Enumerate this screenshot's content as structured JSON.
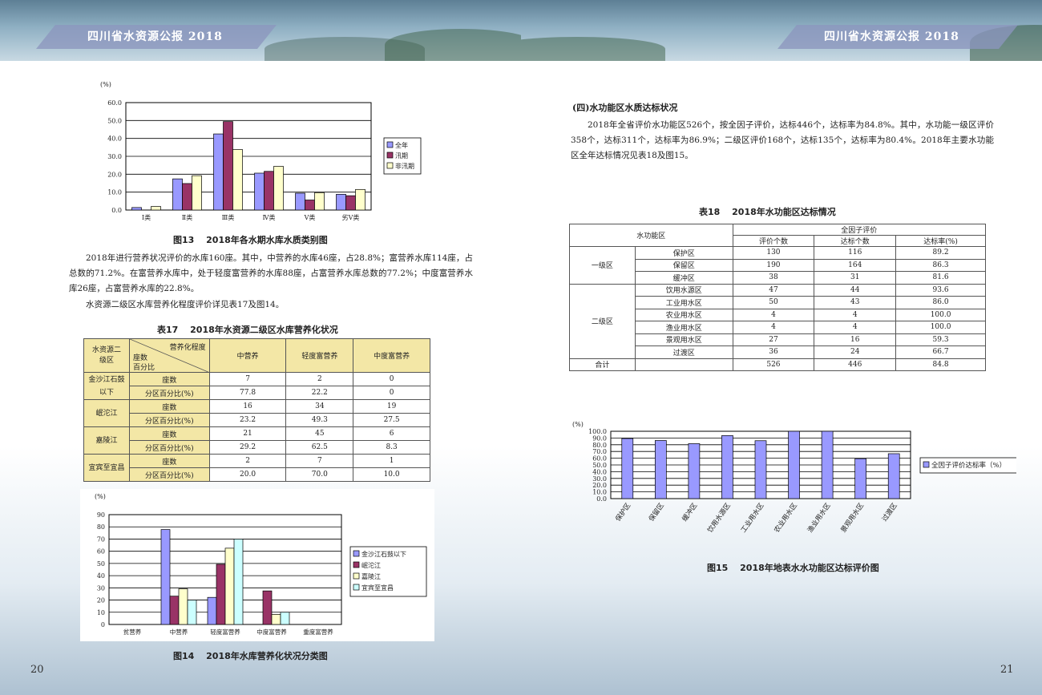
{
  "header": {
    "title": "四川省水资源公报 2018"
  },
  "page_numbers": {
    "left": "20",
    "right": "21"
  },
  "left": {
    "fig13": {
      "caption": "图13　 2018年各水期水库水质类别图",
      "chart_data": {
        "type": "bar",
        "ylabel": "(%)",
        "ylim": [
          0,
          60
        ],
        "yticks": [
          "0.0",
          "10.0",
          "20.0",
          "30.0",
          "40.0",
          "50.0",
          "60.0"
        ],
        "categories": [
          "Ⅰ类",
          "Ⅱ类",
          "Ⅲ类",
          "Ⅳ类",
          "Ⅴ类",
          "劣Ⅴ类"
        ],
        "series": [
          {
            "name": "全年",
            "color": "#9999ff",
            "values": [
              1.4,
              17.4,
              42.5,
              20.6,
              9.4,
              8.8
            ]
          },
          {
            "name": "汛期",
            "color": "#993366",
            "values": [
              0,
              14.8,
              49.4,
              21.6,
              5.6,
              8.0
            ]
          },
          {
            "name": "非汛期",
            "color": "#ffffcc",
            "values": [
              2.0,
              19.2,
              33.8,
              24.4,
              9.7,
              11.5
            ]
          }
        ],
        "legend": "right"
      }
    },
    "para1": "2018年进行营养状况评价的水库160座。其中，中营养的水库46座，占28.8%；富营养水库114座，占总数的71.2%。在富营养水库中，处于轻度富营养的水库88座，占富营养水库总数的77.2%；中度富营养水库26座，占富营养水库的22.8%。",
    "para2": "水资源二级区水库营养化程度评价详见表17及图14。",
    "table17": {
      "caption": "表17　 2018年水资源二级区水库营养化状况",
      "corner_top": "营养化程度",
      "corner_region": "水资源二级区",
      "corner_mid": "座数",
      "corner_bottom": "百分比",
      "col_headers": [
        "中营养",
        "轻度富营养",
        "中度富营养"
      ],
      "label_count": "座数",
      "label_pct": "分区百分比(%)",
      "groups": [
        {
          "name": "金沙江石鼓以下",
          "counts": [
            "7",
            "2",
            "0"
          ],
          "pcts": [
            "77.8",
            "22.2",
            "0"
          ]
        },
        {
          "name": "岷沱江",
          "counts": [
            "16",
            "34",
            "19"
          ],
          "pcts": [
            "23.2",
            "49.3",
            "27.5"
          ]
        },
        {
          "name": "嘉陵江",
          "counts": [
            "21",
            "45",
            "6"
          ],
          "pcts": [
            "29.2",
            "62.5",
            "8.3"
          ]
        },
        {
          "name": "宜宾至宜昌",
          "counts": [
            "2",
            "7",
            "1"
          ],
          "pcts": [
            "20.0",
            "70.0",
            "10.0"
          ]
        }
      ]
    },
    "fig14": {
      "caption": "图14　 2018年水库营养化状况分类图",
      "chart_data": {
        "type": "bar",
        "ylabel": "(%)",
        "ylim": [
          0,
          90
        ],
        "yticks": [
          "0",
          "10",
          "20",
          "30",
          "40",
          "50",
          "60",
          "70",
          "80",
          "90"
        ],
        "categories": [
          "贫营养",
          "中营养",
          "轻度富营养",
          "中度富营养",
          "重度富营养"
        ],
        "series": [
          {
            "name": "金沙江石鼓以下",
            "color": "#9999ff",
            "values": [
              0,
              77.8,
              22.2,
              0,
              0
            ]
          },
          {
            "name": "岷沱江",
            "color": "#993366",
            "values": [
              0,
              23.2,
              49.3,
              27.5,
              0
            ]
          },
          {
            "name": "嘉陵江",
            "color": "#ffffcc",
            "values": [
              0,
              29.2,
              62.5,
              8.3,
              0
            ]
          },
          {
            "name": "宜宾至宜昌",
            "color": "#ccffff",
            "values": [
              0,
              20.0,
              70.0,
              10.0,
              0
            ]
          }
        ],
        "legend": "right"
      }
    }
  },
  "right": {
    "section_heading": "(四)水功能区水质达标状况",
    "para": "2018年全省评价水功能区526个，按全因子评价，达标446个，达标率为84.8%。其中，水功能一级区评价358个，达标311个，达标率为86.9%；二级区评价168个，达标135个，达标率为80.4%。2018年主要水功能区全年达标情况见表18及图15。",
    "table18": {
      "caption": "表18　 2018年水功能区达标情况",
      "header_zone": "水功能区",
      "header_group": "全因子评价",
      "col_headers": [
        "评价个数",
        "达标个数",
        "达标率(%)"
      ],
      "level1": "一级区",
      "level2": "二级区",
      "rows1": [
        {
          "name": "保护区",
          "vals": [
            "130",
            "116",
            "89.2"
          ]
        },
        {
          "name": "保留区",
          "vals": [
            "190",
            "164",
            "86.3"
          ]
        },
        {
          "name": "缓冲区",
          "vals": [
            "38",
            "31",
            "81.6"
          ]
        }
      ],
      "rows2": [
        {
          "name": "饮用水源区",
          "vals": [
            "47",
            "44",
            "93.6"
          ]
        },
        {
          "name": "工业用水区",
          "vals": [
            "50",
            "43",
            "86.0"
          ]
        },
        {
          "name": "农业用水区",
          "vals": [
            "4",
            "4",
            "100.0"
          ]
        },
        {
          "name": "渔业用水区",
          "vals": [
            "4",
            "4",
            "100.0"
          ]
        },
        {
          "name": "景观用水区",
          "vals": [
            "27",
            "16",
            "59.3"
          ]
        },
        {
          "name": "过渡区",
          "vals": [
            "36",
            "24",
            "66.7"
          ]
        }
      ],
      "total": {
        "name": "合计",
        "vals": [
          "526",
          "446",
          "84.8"
        ]
      }
    },
    "fig15": {
      "caption": "图15　 2018年地表水水功能区达标评价图",
      "chart_data": {
        "type": "bar",
        "ylabel": "(%)",
        "ylim": [
          0,
          100
        ],
        "yticks": [
          "0.0",
          "10.0",
          "20.0",
          "30.0",
          "40.0",
          "50.0",
          "60.0",
          "70.0",
          "80.0",
          "90.0",
          "100.0"
        ],
        "categories": [
          "保护区",
          "保留区",
          "缓冲区",
          "饮用水源区",
          "工业用水区",
          "农业用水区",
          "渔业用水区",
          "景观用水区",
          "过渡区"
        ],
        "series": [
          {
            "name": "全因子评价达标率（%）",
            "color": "#9999ff",
            "values": [
              89.2,
              86.3,
              81.6,
              93.6,
              86.0,
              100.0,
              100.0,
              59.3,
              66.7
            ]
          }
        ],
        "legend": "right"
      }
    }
  }
}
